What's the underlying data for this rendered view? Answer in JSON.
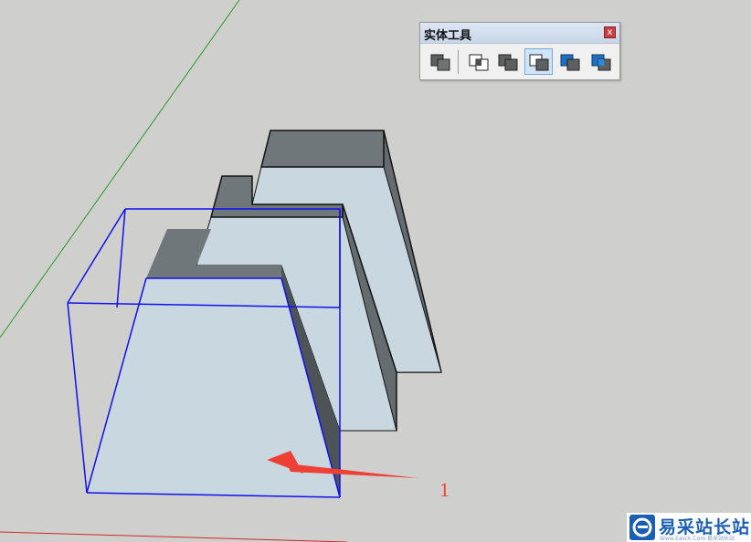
{
  "toolbar": {
    "title": "实体工具",
    "close_label": "x",
    "tools": [
      {
        "name": "solid-inspector-icon",
        "active": false
      },
      {
        "name": "intersect-icon",
        "active": false
      },
      {
        "name": "union-icon",
        "active": false
      },
      {
        "name": "subtract-icon",
        "active": true
      },
      {
        "name": "trim-icon",
        "active": false
      },
      {
        "name": "split-icon",
        "active": false
      }
    ]
  },
  "annotation": {
    "label": "1",
    "color": "#ee4035"
  },
  "watermark": {
    "text": "易采站长站",
    "url": "Www.Easck.Com  易采站长站",
    "color": "#1a5fb4"
  },
  "colors": {
    "background": "#cfcfcd",
    "face_light": "#c9d7e0",
    "face_dark": "#6f777b",
    "selection": "#1010ee",
    "green_axis": "#2a9a2a",
    "red_axis": "#cc2a2a"
  }
}
